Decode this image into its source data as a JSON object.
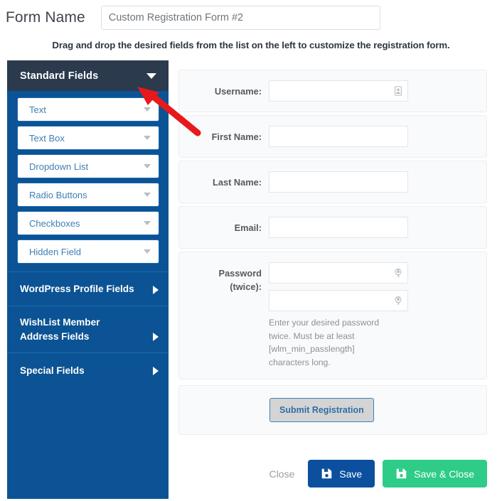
{
  "header": {
    "form_name_label": "Form Name",
    "form_name_value": "Custom Registration Form #2",
    "form_name_placeholder": "Form Name",
    "instructions": "Drag and drop the desired fields from the list on the left to customize the registration form."
  },
  "sidebar": {
    "header_title": "Standard Fields",
    "header_icon": "chevron-down-icon",
    "fields": [
      {
        "label": "Text",
        "icon": "chevron-down-icon"
      },
      {
        "label": "Text Box",
        "icon": "chevron-down-icon"
      },
      {
        "label": "Dropdown List",
        "icon": "chevron-down-icon"
      },
      {
        "label": "Radio Buttons",
        "icon": "chevron-down-icon"
      },
      {
        "label": "Checkboxes",
        "icon": "chevron-down-icon"
      },
      {
        "label": "Hidden Field",
        "icon": "chevron-down-icon"
      }
    ],
    "groups": [
      {
        "label": "WordPress Profile Fields",
        "icon": "chevron-right-icon"
      },
      {
        "label": "WishList Member Address Fields",
        "icon": "chevron-right-icon"
      },
      {
        "label": "Special Fields",
        "icon": "chevron-right-icon"
      }
    ]
  },
  "form_preview": {
    "rows": [
      {
        "label": "Username:",
        "value": "",
        "placeholder": "",
        "icon": "user-card-icon"
      },
      {
        "label": "First Name:",
        "value": "",
        "placeholder": "",
        "icon": ""
      },
      {
        "label": "Last Name:",
        "value": "",
        "placeholder": "",
        "icon": ""
      },
      {
        "label": "Email:",
        "value": "",
        "placeholder": "",
        "icon": ""
      }
    ],
    "password": {
      "label": "Password (twice):",
      "label_line1": "Password",
      "label_line2": "(twice):",
      "first_value": "",
      "second_value": "",
      "icon": "key-lock-icon",
      "help_text": "Enter your desired password twice. Must be at least [wlm_min_passlength] characters long."
    },
    "submit_label": "Submit Registration"
  },
  "actions": {
    "close_label": "Close",
    "save_label": "Save",
    "save_close_label": "Save & Close",
    "save_icon": "floppy-disk-icon",
    "save_close_icon": "floppy-disk-icon"
  },
  "annotation": {
    "type": "arrow",
    "color": "#e8191b",
    "points_to": "Standard Fields"
  },
  "colors": {
    "sidebar_header": "#2b3a4d",
    "sidebar_body": "#0b5394",
    "save": "#0b4f9e",
    "save_close": "#2ecc87",
    "accent_link": "#3f7fb5",
    "annotation": "#e8191b"
  }
}
